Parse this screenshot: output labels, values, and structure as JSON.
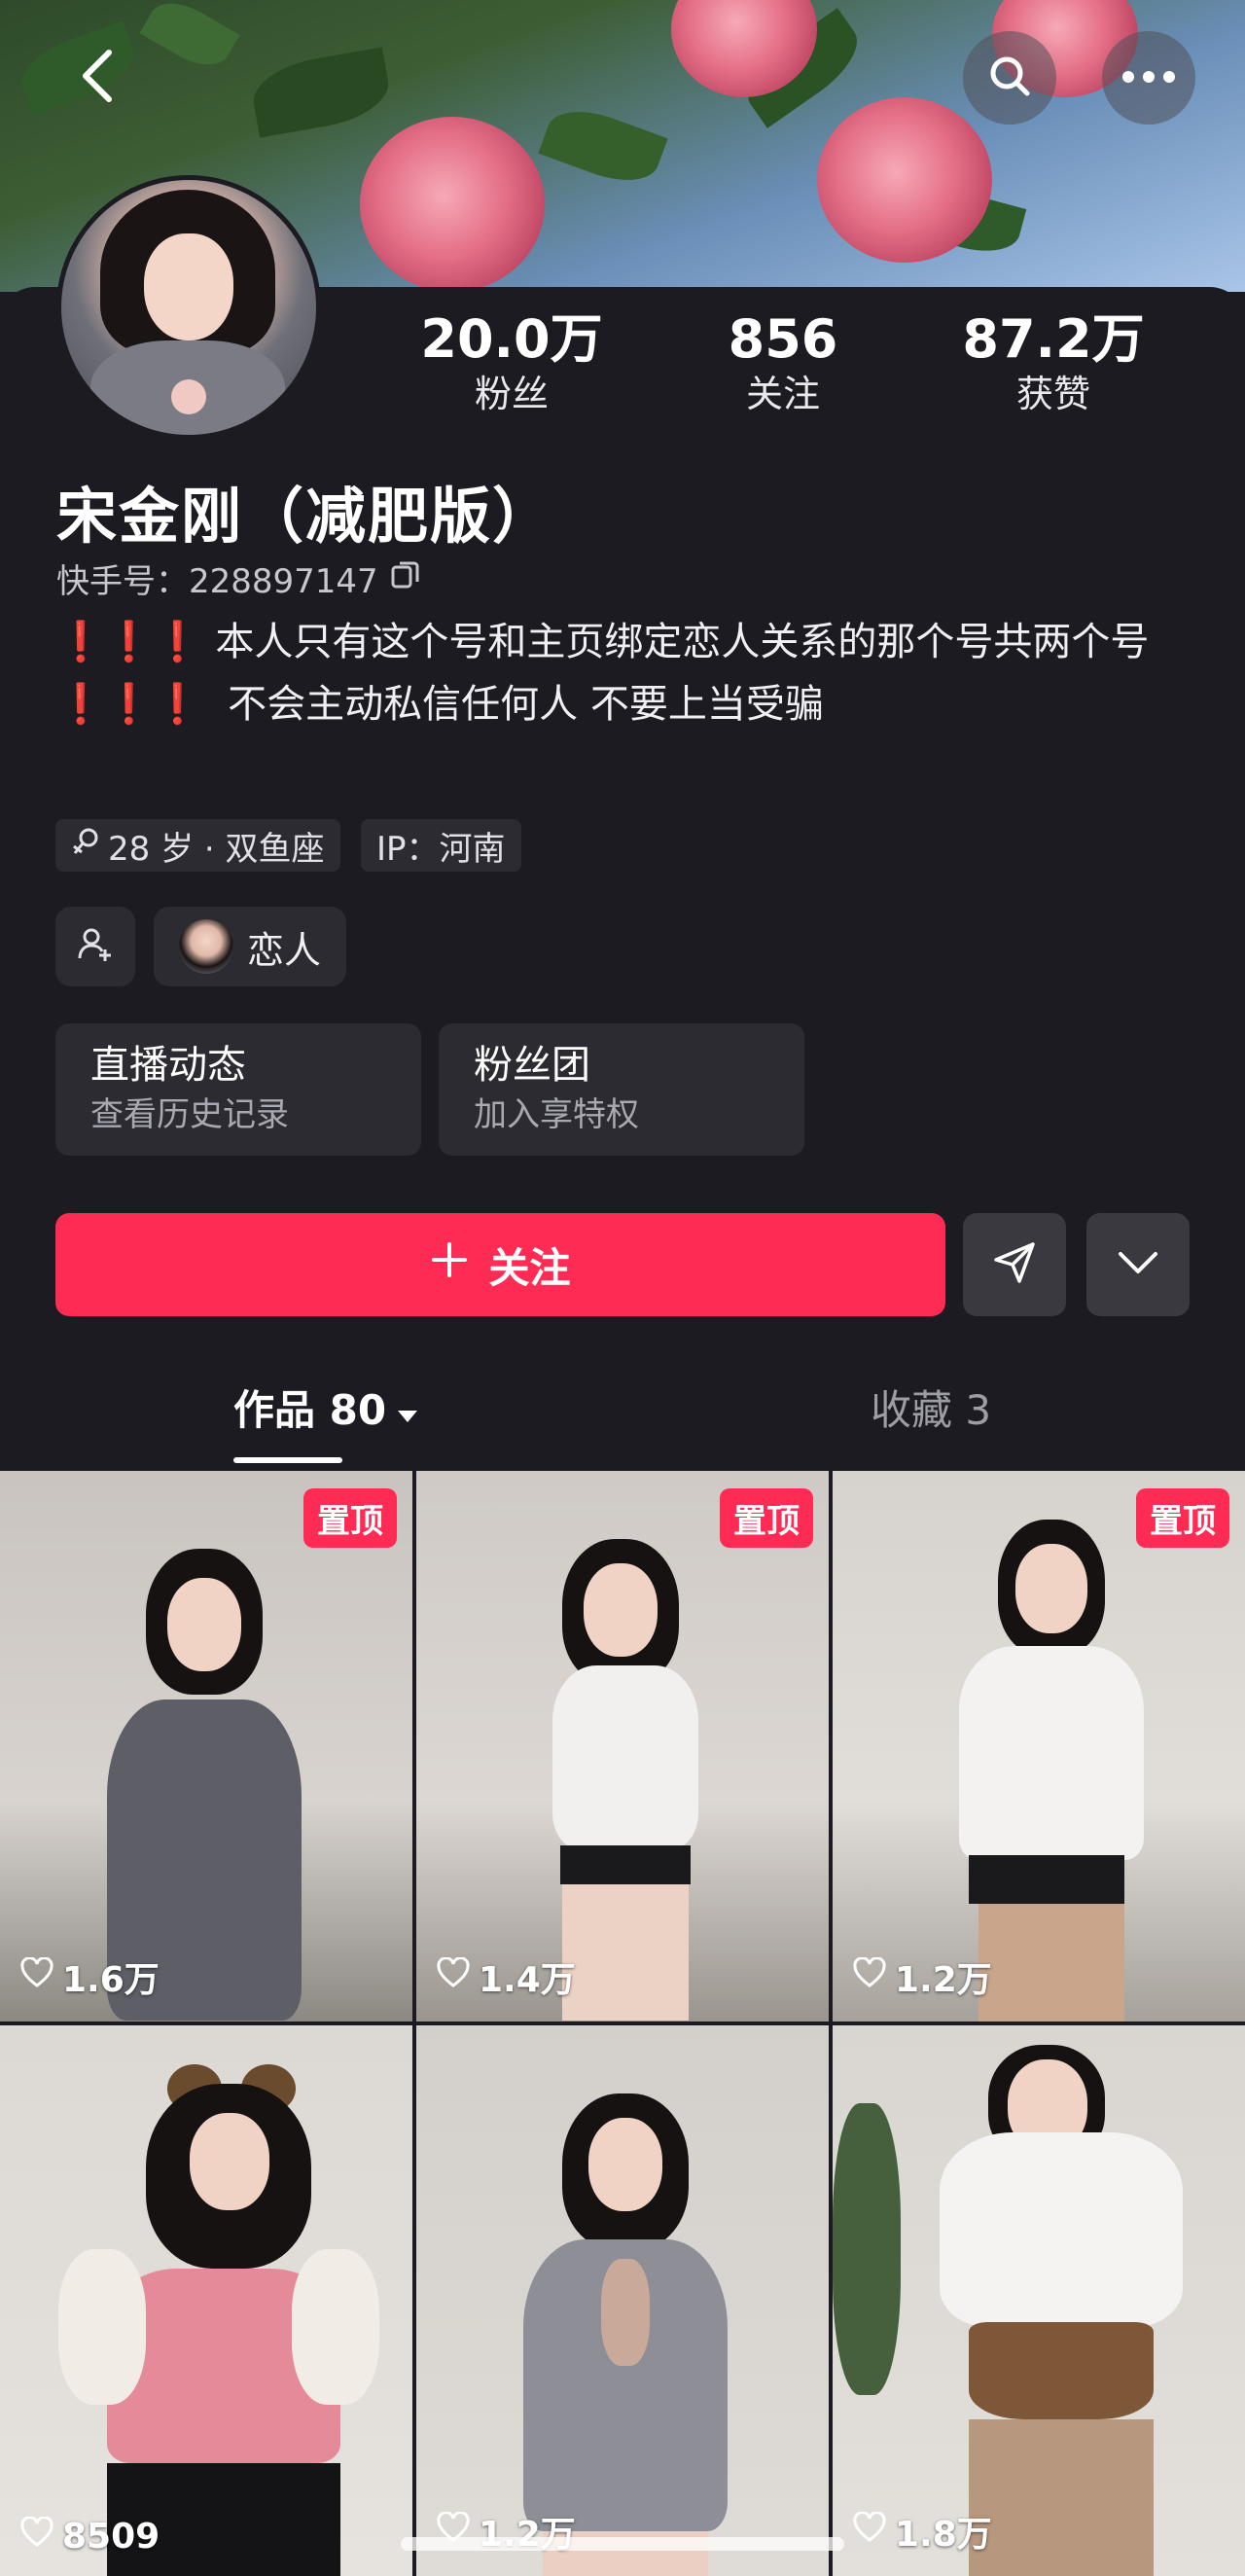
{
  "header": {
    "back_icon": "chevron-left-icon",
    "search_icon": "search-icon",
    "more_icon": "more-horizontal-icon"
  },
  "profile": {
    "name": "宋金刚（减肥版）",
    "uid_label": "快手号：228897147",
    "stats": [
      {
        "value": "20.0万",
        "label": "粉丝"
      },
      {
        "value": "856",
        "label": "关注"
      },
      {
        "value": "87.2万",
        "label": "获赞"
      }
    ],
    "bio_line1_marks": "❗❗❗",
    "bio_line1": "本人只有这个号和主页绑定恋人关系的那个号共两个号",
    "bio_line2_marks": "❗❗❗",
    "bio_line2": " 不会主动私信任何人 不要上当受骗",
    "tags": [
      {
        "text": "28 岁 · 双鱼座",
        "icon": "female-icon"
      },
      {
        "text": "IP：河南"
      }
    ],
    "relation_label": "恋人"
  },
  "cards": [
    {
      "title": "直播动态",
      "subtitle": "查看历史记录"
    },
    {
      "title": "粉丝团",
      "subtitle": "加入享特权"
    }
  ],
  "actions": {
    "follow_label": "关注",
    "accent_color": "#fe2c55"
  },
  "tabs": [
    {
      "label": "作品 80",
      "active": true
    },
    {
      "label": "收藏 3",
      "active": false
    }
  ],
  "videos": [
    {
      "likes": "1.6万",
      "pinned": "置顶"
    },
    {
      "likes": "1.4万",
      "pinned": "置顶"
    },
    {
      "likes": "1.2万",
      "pinned": "置顶"
    },
    {
      "likes": "8509"
    },
    {
      "likes": "1.2万"
    },
    {
      "likes": "1.8万"
    }
  ]
}
